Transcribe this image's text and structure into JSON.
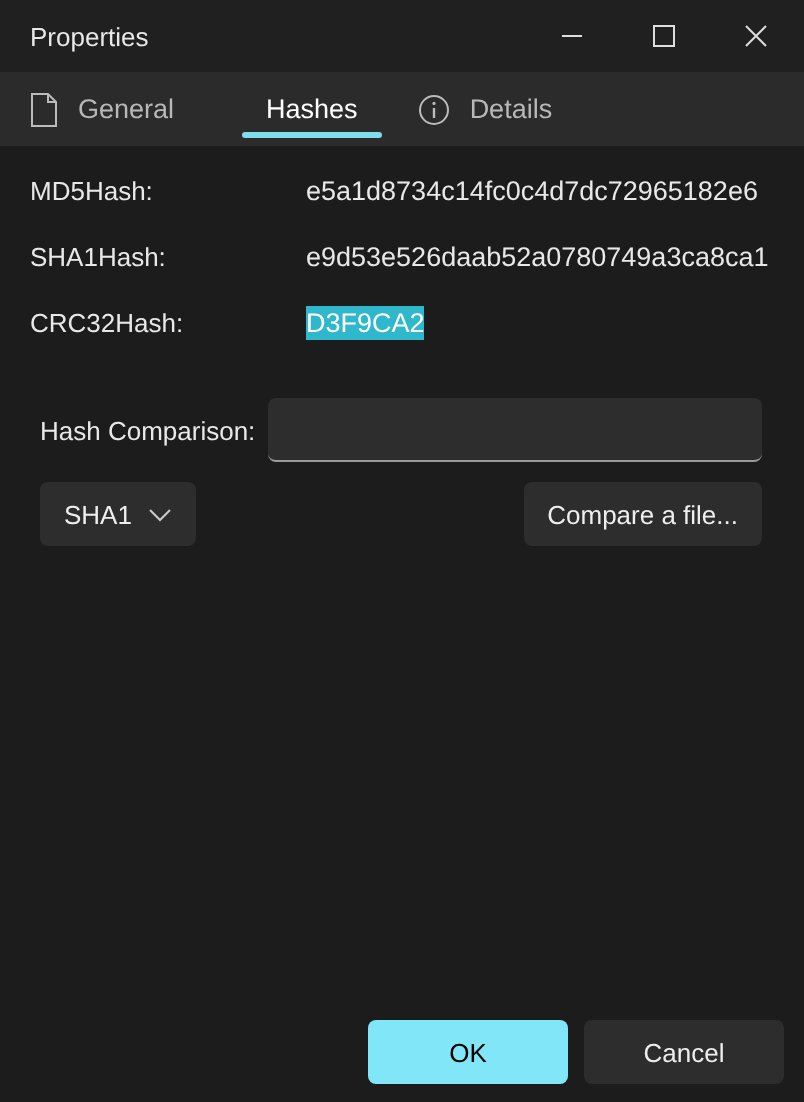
{
  "window": {
    "title": "Properties"
  },
  "tabs": [
    {
      "label": "General",
      "kind": "document",
      "selected": false
    },
    {
      "label": "Hashes",
      "kind": "plain",
      "selected": true
    },
    {
      "label": "Details",
      "kind": "info",
      "selected": false
    }
  ],
  "hashes": [
    {
      "label": "MD5Hash:",
      "value": "e5a1d8734c14fc0c4d7dc72965182e6",
      "selected": false
    },
    {
      "label": "SHA1Hash:",
      "value": "e9d53e526daab52a0780749a3ca8ca1",
      "selected": false
    },
    {
      "label": "CRC32Hash:",
      "value": "D3F9CA2",
      "selected": true
    }
  ],
  "comparison": {
    "label": "Hash Comparison:"
  },
  "algorithm": "SHA1",
  "compare_button": "Compare a file...",
  "buttons": [
    {
      "label": "OK",
      "primary": true
    },
    {
      "label": "Cancel",
      "primary": false
    }
  ]
}
